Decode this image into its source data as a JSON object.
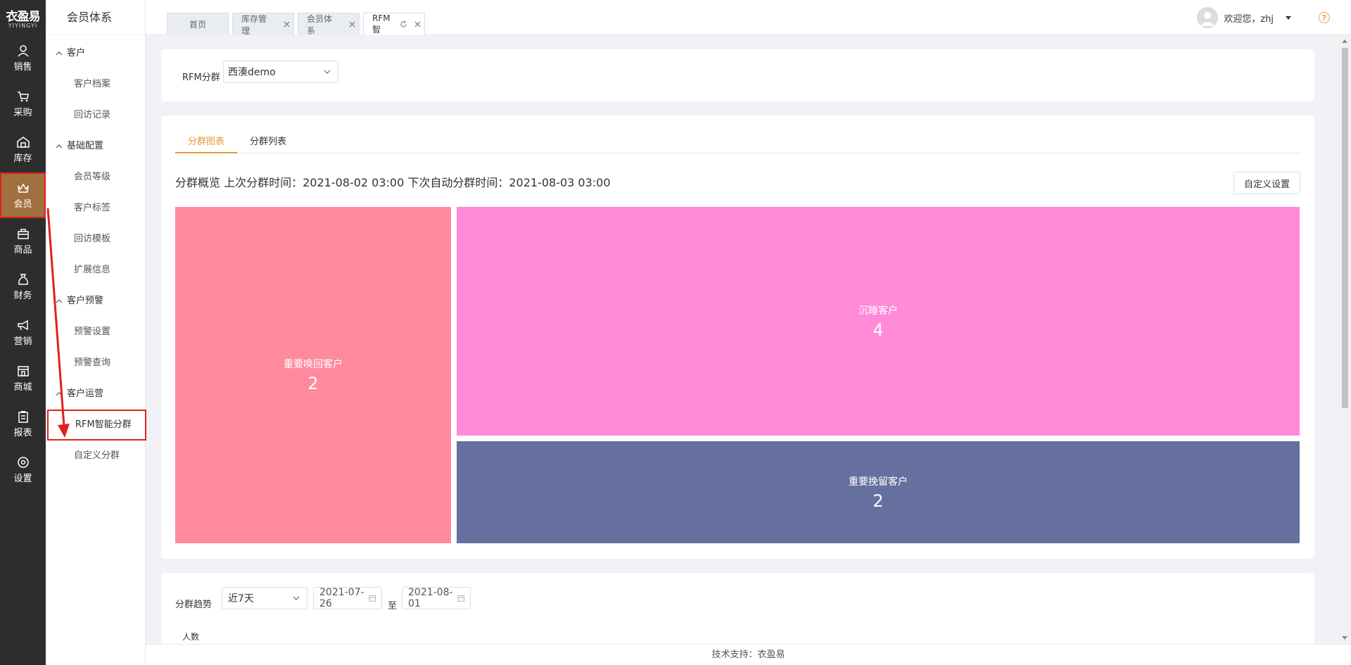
{
  "logo": {
    "cn": "衣盈易",
    "en": "YIYINGYI"
  },
  "rail": [
    {
      "label": "销售",
      "icon": "person-icon"
    },
    {
      "label": "采购",
      "icon": "cart-icon"
    },
    {
      "label": "库存",
      "icon": "warehouse-icon"
    },
    {
      "label": "会员",
      "icon": "crown-icon",
      "active": true
    },
    {
      "label": "商品",
      "icon": "bag-icon"
    },
    {
      "label": "财务",
      "icon": "money-bag-icon"
    },
    {
      "label": "营销",
      "icon": "megaphone-icon"
    },
    {
      "label": "商城",
      "icon": "store-icon"
    },
    {
      "label": "报表",
      "icon": "clipboard-icon"
    },
    {
      "label": "设置",
      "icon": "settings-icon"
    }
  ],
  "subnav": {
    "title": "会员体系",
    "groups": [
      {
        "label": "客户",
        "items": [
          "客户档案",
          "回访记录"
        ]
      },
      {
        "label": "基础配置",
        "items": [
          "会员等级",
          "客户标签",
          "回访模板",
          "扩展信息"
        ]
      },
      {
        "label": "客户预警",
        "items": [
          "预警设置",
          "预警查询"
        ]
      },
      {
        "label": "客户运营",
        "items": [
          "RFM智能分群",
          "自定义分群"
        ]
      }
    ],
    "active_item": "RFM智能分群"
  },
  "tabs": [
    {
      "label": "首页",
      "closable": false
    },
    {
      "label": "库存管理",
      "closable": true
    },
    {
      "label": "会员体系",
      "closable": true
    },
    {
      "label": "RFM智",
      "closable": true,
      "active": true,
      "refresh": true
    }
  ],
  "user": {
    "greeting": "欢迎您，zhj"
  },
  "filter": {
    "label": "RFM分群",
    "value": "西湊demo"
  },
  "chart_tabs": [
    "分群图表",
    "分群列表"
  ],
  "overview": "分群概览 上次分群时间：2021-08-02 03:00 下次自动分群时间：2021-08-03 03:00",
  "custom_button": "自定义设置",
  "chart_data": {
    "type": "treemap",
    "series": [
      {
        "name": "重要唤回客户",
        "value": 2,
        "color": "#ff8a9e"
      },
      {
        "name": "沉睡客户",
        "value": 4,
        "color": "#ff8ad8"
      },
      {
        "name": "重要挽留客户",
        "value": 2,
        "color": "#66709e"
      }
    ]
  },
  "trend": {
    "label": "分群趋势",
    "range": "近7天",
    "start_date": "2021-07-26",
    "to": "至",
    "end_date": "2021-08-01",
    "ylabel": "人数"
  },
  "footer": "技术支持：衣盈易",
  "colors": {
    "accent": "#e8963c",
    "rail_bg": "#2d2d2d",
    "rail_active": "#a0703e",
    "annotation": "#e02020"
  }
}
